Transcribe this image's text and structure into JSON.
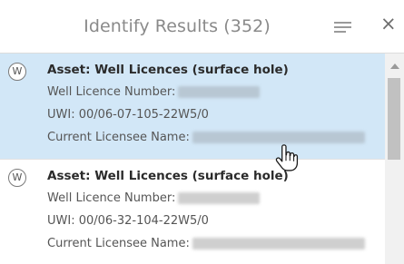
{
  "header": {
    "title": "Identify Results (352)",
    "menu_icon": "hamburger-menu-icon",
    "close_label": "×"
  },
  "results": [
    {
      "badge": "W",
      "asset": "Asset: Well Licences (surface hole)",
      "licence_label": "Well Licence Number:",
      "uwi": "UWI: 00/06-07-105-22W5/0",
      "licensee_label": "Current Licensee Name:",
      "selected": true
    },
    {
      "badge": "W",
      "asset": "Asset: Well Licences (surface hole)",
      "licence_label": "Well Licence Number:",
      "uwi": "UWI: 00/06-32-104-22W5/0",
      "licensee_label": "Current Licensee Name:",
      "selected": false
    }
  ],
  "colors": {
    "selected_bg": "#d2e7f7",
    "header_text": "#8a8a8a"
  }
}
